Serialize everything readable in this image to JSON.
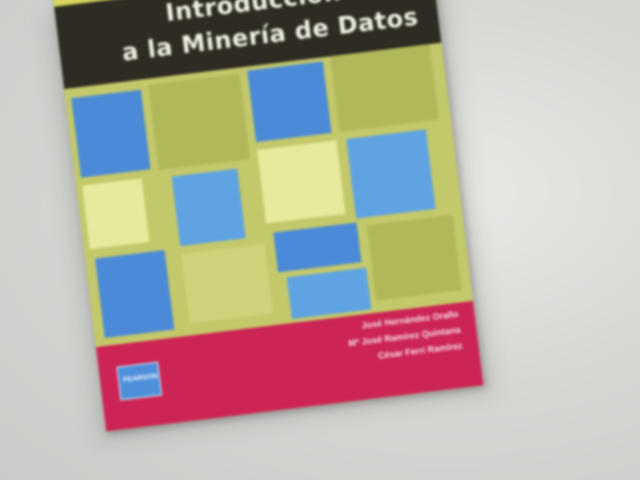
{
  "book": {
    "title_line_1": "Introducción",
    "title_line_2": "a la Minería de Datos",
    "authors": [
      "José Hernández Orallo",
      "Mª José Ramírez Quintana",
      "César Ferri Ramírez"
    ],
    "publisher_logo": "PEARSON"
  },
  "colors": {
    "title_band": "#2d2b22",
    "footer_band": "#cc2454",
    "blue_tile": "#4b8ad6",
    "pale_tile": "#e5ea9c",
    "olive_tile": "#b1b85a",
    "background": "#d7d8d4"
  }
}
